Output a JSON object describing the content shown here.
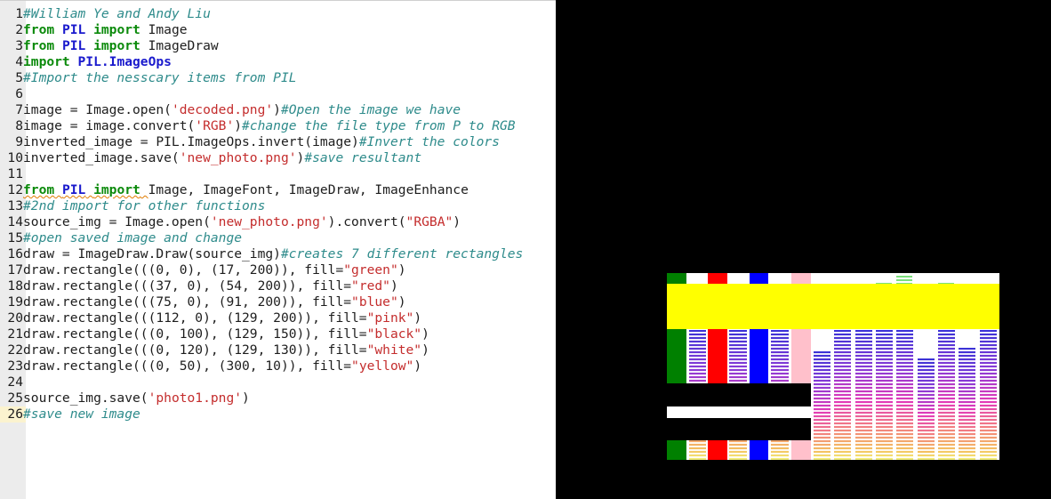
{
  "editor": {
    "current_line": 26,
    "lines": [
      {
        "n": "1",
        "segments": [
          {
            "t": "#William Ye and Andy Liu",
            "c": "cm"
          }
        ]
      },
      {
        "n": "2",
        "segments": [
          {
            "t": "from",
            "c": "kw"
          },
          {
            "t": " "
          },
          {
            "t": "PIL",
            "c": "mod"
          },
          {
            "t": " "
          },
          {
            "t": "import",
            "c": "kw"
          },
          {
            "t": " Image"
          }
        ]
      },
      {
        "n": "3",
        "segments": [
          {
            "t": "from",
            "c": "kw"
          },
          {
            "t": " "
          },
          {
            "t": "PIL",
            "c": "mod"
          },
          {
            "t": " "
          },
          {
            "t": "import",
            "c": "kw"
          },
          {
            "t": " ImageDraw"
          }
        ]
      },
      {
        "n": "4",
        "segments": [
          {
            "t": "import",
            "c": "kw"
          },
          {
            "t": " "
          },
          {
            "t": "PIL.ImageOps",
            "c": "mod"
          }
        ]
      },
      {
        "n": "5",
        "segments": [
          {
            "t": "#Import the nesscary items from PIL",
            "c": "cm"
          }
        ]
      },
      {
        "n": "6",
        "segments": []
      },
      {
        "n": "7",
        "segments": [
          {
            "t": "image = Image.open("
          },
          {
            "t": "'decoded.png'",
            "c": "st"
          },
          {
            "t": ")"
          },
          {
            "t": "#Open the image we have",
            "c": "cm"
          }
        ]
      },
      {
        "n": "8",
        "segments": [
          {
            "t": "image = image.convert("
          },
          {
            "t": "'RGB'",
            "c": "st"
          },
          {
            "t": ")"
          },
          {
            "t": "#change the file type from P to RGB",
            "c": "cm"
          }
        ]
      },
      {
        "n": "9",
        "segments": [
          {
            "t": "inverted_image = PIL.ImageOps.invert(image)"
          },
          {
            "t": "#Invert the colors",
            "c": "cm"
          }
        ]
      },
      {
        "n": "10",
        "segments": [
          {
            "t": "inverted_image.save("
          },
          {
            "t": "'new_photo.png'",
            "c": "st"
          },
          {
            "t": ")"
          },
          {
            "t": "#save resultant",
            "c": "cm"
          }
        ]
      },
      {
        "n": "11",
        "segments": []
      },
      {
        "n": "12",
        "segments": [
          {
            "t": "from",
            "c": "kw sq"
          },
          {
            "t": " ",
            "c": "sq"
          },
          {
            "t": "PIL",
            "c": "mod sq"
          },
          {
            "t": " ",
            "c": "sq"
          },
          {
            "t": "import",
            "c": "kw sq"
          },
          {
            "t": " ",
            "c": "sq"
          },
          {
            "t": "Image, ImageFont, ImageDraw, ImageEnhance"
          }
        ]
      },
      {
        "n": "13",
        "segments": [
          {
            "t": "#2nd import for other functions",
            "c": "cm"
          }
        ]
      },
      {
        "n": "14",
        "segments": [
          {
            "t": "source_img = Image.open("
          },
          {
            "t": "'new_photo.png'",
            "c": "st"
          },
          {
            "t": ").convert("
          },
          {
            "t": "\"RGBA\"",
            "c": "st"
          },
          {
            "t": ")"
          }
        ]
      },
      {
        "n": "15",
        "segments": [
          {
            "t": "#open saved image and change",
            "c": "cm"
          }
        ]
      },
      {
        "n": "16",
        "segments": [
          {
            "t": "draw = ImageDraw.Draw(source_img)"
          },
          {
            "t": "#creates 7 different rectangles",
            "c": "cm"
          }
        ]
      },
      {
        "n": "17",
        "segments": [
          {
            "t": "draw.rectangle(((0, 0), (17, 200)), fill="
          },
          {
            "t": "\"green\"",
            "c": "st"
          },
          {
            "t": ")"
          }
        ]
      },
      {
        "n": "18",
        "segments": [
          {
            "t": "draw.rectangle(((37, 0), (54, 200)), fill="
          },
          {
            "t": "\"red\"",
            "c": "st"
          },
          {
            "t": ")"
          }
        ]
      },
      {
        "n": "19",
        "segments": [
          {
            "t": "draw.rectangle(((75, 0), (91, 200)), fill="
          },
          {
            "t": "\"blue\"",
            "c": "st"
          },
          {
            "t": ")"
          }
        ]
      },
      {
        "n": "20",
        "segments": [
          {
            "t": "draw.rectangle(((112, 0), (129, 200)), fill="
          },
          {
            "t": "\"pink\"",
            "c": "st"
          },
          {
            "t": ")"
          }
        ]
      },
      {
        "n": "21",
        "segments": [
          {
            "t": "draw.rectangle(((0, 100), (129, 150)), fill="
          },
          {
            "t": "\"black\"",
            "c": "st"
          },
          {
            "t": ")"
          }
        ]
      },
      {
        "n": "22",
        "segments": [
          {
            "t": "draw.rectangle(((0, 120), (129, 130)), fill="
          },
          {
            "t": "\"white\"",
            "c": "st"
          },
          {
            "t": ")"
          }
        ]
      },
      {
        "n": "23",
        "segments": [
          {
            "t": "draw.rectangle(((0, 50), (300, 10)), fill="
          },
          {
            "t": "\"yellow\"",
            "c": "st"
          },
          {
            "t": ")"
          }
        ]
      },
      {
        "n": "24",
        "segments": []
      },
      {
        "n": "25",
        "segments": [
          {
            "t": "source_img.save("
          },
          {
            "t": "'photo1.png'",
            "c": "st"
          },
          {
            "t": ")"
          }
        ]
      },
      {
        "n": "26",
        "segments": [
          {
            "t": "#save new image",
            "c": "cm"
          }
        ]
      }
    ]
  },
  "output_image": {
    "colors": {
      "green": "#008000",
      "red": "#ff0000",
      "blue": "#0000ff",
      "pink": "#ffc0cb",
      "black": "#000000",
      "white": "#ffffff",
      "yellow": "#ffff00"
    }
  }
}
